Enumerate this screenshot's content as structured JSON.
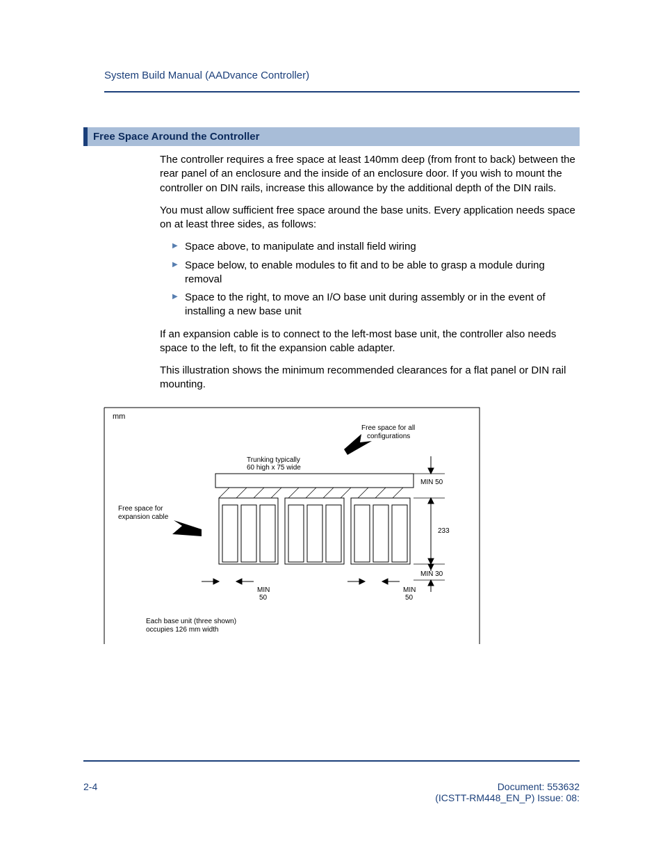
{
  "header": {
    "running_head": "System Build Manual  (AADvance Controller)"
  },
  "section": {
    "title": "Free Space Around the Controller",
    "p1": "The controller requires a free space at least 140mm deep (from front to back) between the rear panel of an enclosure and the inside of an enclosure door. If you wish to mount the controller on DIN rails, increase this allowance by the additional depth of the DIN rails.",
    "p2": "You must allow sufficient free space around the base units. Every application needs space on at least three sides, as follows:",
    "bullets": [
      "Space above, to manipulate and install field wiring",
      "Space below, to enable modules to fit and to be able to grasp a module during removal",
      "Space to the right, to move an I/O base unit during assembly or in the event of installing a new base unit"
    ],
    "p3": "If an expansion cable is to connect to the left-most base unit, the controller also needs space to the left, to fit the expansion cable adapter.",
    "p4": "This illustration shows the minimum recommended clearances for a flat panel or DIN rail mounting."
  },
  "figure": {
    "unit_label": "mm",
    "labels": {
      "free_space_all_1": "Free space for all",
      "free_space_all_2": "configurations",
      "trunking_1": "Trunking typically",
      "trunking_2": "60 high x 75 wide",
      "free_space_exp_1": "Free space for",
      "free_space_exp_2": "expansion cable",
      "base_unit_1": "Each base unit (three shown)",
      "base_unit_2": "occupies 126 mm width",
      "min50_top": "MIN 50",
      "dim233": "233",
      "min30": "MIN 30",
      "min_left": "MIN",
      "fifty_left": "50",
      "min_right": "MIN",
      "fifty_right": "50"
    }
  },
  "footer": {
    "page_num": "2-4",
    "doc_line1": "Document: 553632",
    "doc_line2": "(ICSTT-RM448_EN_P) Issue: 08:"
  }
}
